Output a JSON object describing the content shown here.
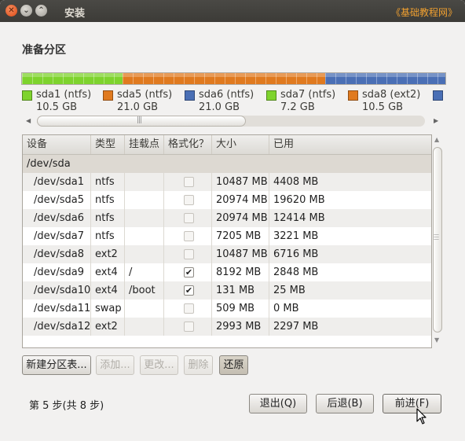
{
  "window": {
    "title": "安装",
    "watermark": "《基础教程网》"
  },
  "page": {
    "title": "准备分区"
  },
  "partition_bar": {
    "segments": [
      {
        "name": "sda1",
        "color": "#7ed32d",
        "size_mb": 10487
      },
      {
        "name": "sda5",
        "color": "#e07a1f",
        "size_mb": 20974
      },
      {
        "name": "sda6",
        "color": "#4a6fb5",
        "size_mb": 20974
      }
    ]
  },
  "legend": [
    {
      "name": "sda1 (ntfs)",
      "size": "10.5 GB",
      "color": "#7ed32d"
    },
    {
      "name": "sda5 (ntfs)",
      "size": "21.0 GB",
      "color": "#e07a1f"
    },
    {
      "name": "sda6 (ntfs)",
      "size": "21.0 GB",
      "color": "#4a6fb5"
    },
    {
      "name": "sda7 (ntfs)",
      "size": "7.2 GB",
      "color": "#7ed32d"
    },
    {
      "name": "sda8 (ext2)",
      "size": "10.5 GB",
      "color": "#e07a1f"
    },
    {
      "name": "",
      "size": "",
      "color": "#4a6fb5"
    }
  ],
  "table": {
    "columns": [
      "设备",
      "类型",
      "挂载点",
      "格式化？",
      "大小",
      "已用"
    ],
    "group": "/dev/sda",
    "rows": [
      {
        "device": "/dev/sda1",
        "type": "ntfs",
        "mount": "",
        "format": false,
        "size": "10487 MB",
        "used": "4408 MB"
      },
      {
        "device": "/dev/sda5",
        "type": "ntfs",
        "mount": "",
        "format": false,
        "size": "20974 MB",
        "used": "19620 MB"
      },
      {
        "device": "/dev/sda6",
        "type": "ntfs",
        "mount": "",
        "format": false,
        "size": "20974 MB",
        "used": "12414 MB"
      },
      {
        "device": "/dev/sda7",
        "type": "ntfs",
        "mount": "",
        "format": false,
        "size": "7205 MB",
        "used": "3221 MB"
      },
      {
        "device": "/dev/sda8",
        "type": "ext2",
        "mount": "",
        "format": false,
        "size": "10487 MB",
        "used": "6716 MB"
      },
      {
        "device": "/dev/sda9",
        "type": "ext4",
        "mount": "/",
        "format": true,
        "size": "8192 MB",
        "used": "2848 MB"
      },
      {
        "device": "/dev/sda10",
        "type": "ext4",
        "mount": "/boot",
        "format": true,
        "size": "131 MB",
        "used": "25 MB"
      },
      {
        "device": "/dev/sda11",
        "type": "swap",
        "mount": "",
        "format": false,
        "size": "509 MB",
        "used": "0 MB"
      },
      {
        "device": "/dev/sda12",
        "type": "ext2",
        "mount": "",
        "format": false,
        "size": "2993 MB",
        "used": "2297 MB"
      }
    ]
  },
  "actions": {
    "new_table": "新建分区表...",
    "add": "添加...",
    "change": "更改...",
    "delete": "删除",
    "revert": "还原"
  },
  "footer": {
    "step": "第 5 步(共 8 步)",
    "quit": "退出(Q)",
    "back": "后退(B)",
    "forward": "前进(F)"
  }
}
